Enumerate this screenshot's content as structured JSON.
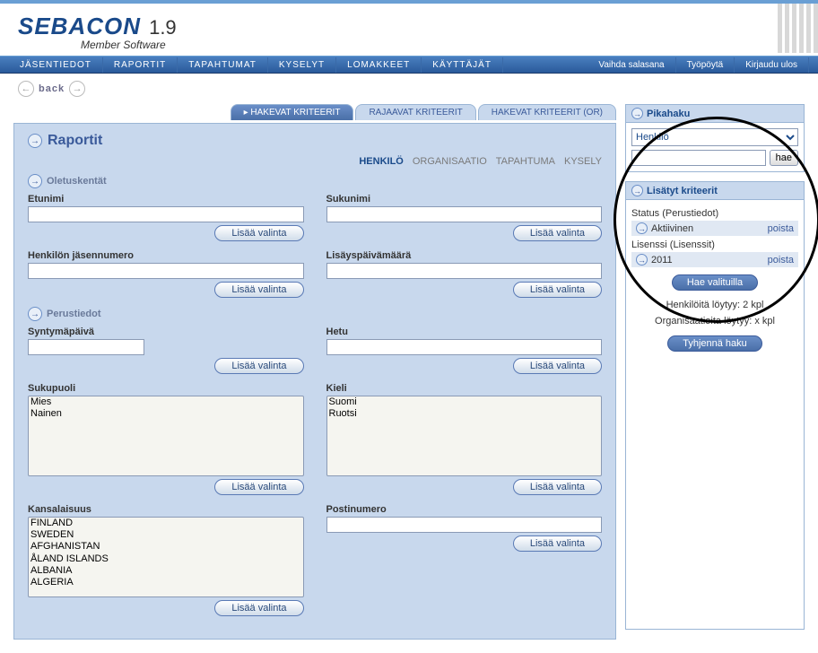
{
  "brand": {
    "name": "SEBACON",
    "version": "1.9",
    "tagline": "Member Software"
  },
  "nav": {
    "left": [
      "JÄSENTIEDOT",
      "RAPORTIT",
      "TAPAHTUMAT",
      "KYSELYT",
      "LOMAKKEET",
      "KÄYTTÄJÄT"
    ],
    "right": [
      "Vaihda salasana",
      "Työpöytä",
      "Kirjaudu ulos"
    ]
  },
  "back_label": "back",
  "subtabs": [
    "HAKEVAT KRITEERIT",
    "RAJAAVAT KRITEERIT",
    "HAKEVAT KRITEERIT (OR)"
  ],
  "page_title": "Raportit",
  "view_tabs": [
    "HENKILÖ",
    "ORGANISAATIO",
    "TAPAHTUMA",
    "KYSELY"
  ],
  "sections": {
    "oletuskentat": "Oletuskentät",
    "perustiedot": "Perustiedot"
  },
  "fields": {
    "etunimi": "Etunimi",
    "sukunimi": "Sukunimi",
    "jasennumero": "Henkilön jäsennumero",
    "lisayspaiva": "Lisäyspäivämäärä",
    "syntymapaiva": "Syntymäpäivä",
    "hetu": "Hetu",
    "sukupuoli": "Sukupuoli",
    "kieli": "Kieli",
    "kansalaisuus": "Kansalaisuus",
    "postinumero": "Postinumero"
  },
  "options": {
    "sukupuoli": [
      "Mies",
      "Nainen"
    ],
    "kieli": [
      "Suomi",
      "Ruotsi"
    ],
    "kansalaisuus": [
      "FINLAND",
      "SWEDEN",
      "AFGHANISTAN",
      "ÅLAND ISLANDS",
      "ALBANIA",
      "ALGERIA"
    ]
  },
  "btn_add": "Lisää valinta",
  "quicksearch": {
    "title": "Pikahaku",
    "selected": "Henkilö",
    "search_btn": "hae"
  },
  "criteria": {
    "title": "Lisätyt kriteerit",
    "groups": [
      {
        "label": "Status (Perustiedot)",
        "value": "Aktiivinen"
      },
      {
        "label": "Lisenssi (Lisenssit)",
        "value": "2011"
      }
    ],
    "remove": "poista",
    "search_btn": "Hae valituilla",
    "results_persons": "Henkilöitä löytyy: 2 kpl",
    "results_orgs": "Organisaatioita löytyy: x kpl",
    "clear_btn": "Tyhjennä haku"
  }
}
